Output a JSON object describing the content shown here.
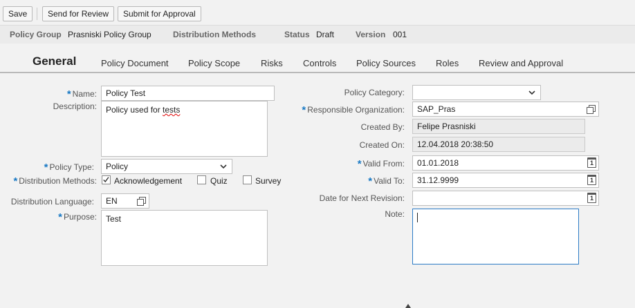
{
  "toolbar": {
    "save": "Save",
    "send_for_review": "Send for Review",
    "submit_for_approval": "Submit for Approval"
  },
  "header": {
    "policy_group_label": "Policy Group",
    "policy_group_value": "Prasniski Policy Group",
    "distribution_methods_label": "Distribution Methods",
    "status_label": "Status",
    "status_value": "Draft",
    "version_label": "Version",
    "version_value": "001"
  },
  "tabs": [
    "General",
    "Policy Document",
    "Policy Scope",
    "Risks",
    "Controls",
    "Policy Sources",
    "Roles",
    "Review and Approval"
  ],
  "form": {
    "name": {
      "label": "Name:",
      "value": "Policy Test"
    },
    "description": {
      "label": "Description:",
      "value_plain": "Policy used for ",
      "value_misspelled": "tests"
    },
    "policy_type": {
      "label": "Policy Type:",
      "value": "Policy"
    },
    "distribution_methods": {
      "label": "Distribution Methods:",
      "options": [
        {
          "label": "Acknowledgement",
          "checked": true
        },
        {
          "label": "Quiz",
          "checked": false
        },
        {
          "label": "Survey",
          "checked": false
        }
      ]
    },
    "distribution_language": {
      "label": "Distribution Language:",
      "value": "EN"
    },
    "purpose": {
      "label": "Purpose:",
      "value": "Test"
    },
    "policy_category": {
      "label": "Policy Category:",
      "value": ""
    },
    "responsible_org": {
      "label": "Responsible Organization:",
      "value": "SAP_Pras"
    },
    "created_by": {
      "label": "Created By:",
      "value": "Felipe Prasniski"
    },
    "created_on": {
      "label": "Created On:",
      "value": "12.04.2018 20:38:50"
    },
    "valid_from": {
      "label": "Valid From:",
      "value": "01.01.2018"
    },
    "valid_to": {
      "label": "Valid To:",
      "value": "31.12.9999"
    },
    "next_revision": {
      "label": "Date for Next Revision:",
      "value": ""
    },
    "note": {
      "label": "Note:",
      "value": ""
    }
  },
  "icons": {
    "calendar_day": "1"
  },
  "colors": {
    "required_marker": "#1979c4",
    "focus_border": "#2b7bc6"
  }
}
